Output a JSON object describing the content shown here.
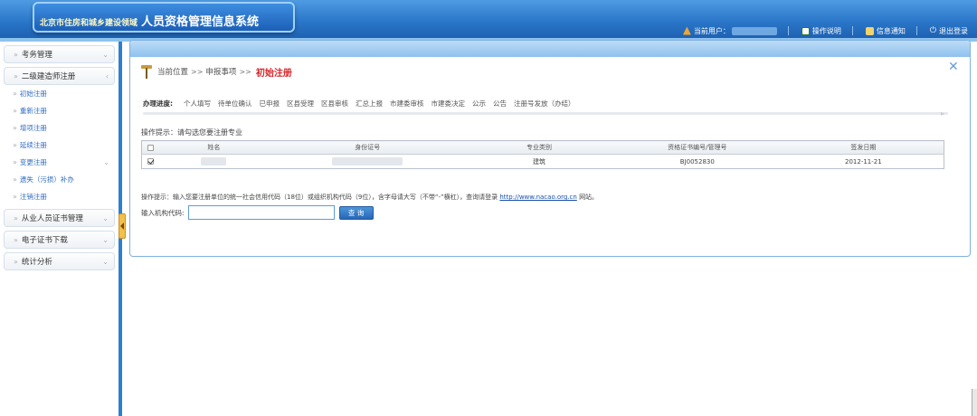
{
  "header": {
    "logo_small": "北京市住房和城乡建设领域",
    "logo_big": "人员资格管理信息系统",
    "current_user_label": "当前用户：",
    "help": "操作说明",
    "notice": "信息通知",
    "logout": "退出登录"
  },
  "sidebar": {
    "groups": [
      {
        "label": "考务管理"
      },
      {
        "label": "二级建造师注册"
      }
    ],
    "sub_items": [
      {
        "label": "初始注册"
      },
      {
        "label": "重新注册"
      },
      {
        "label": "增项注册"
      },
      {
        "label": "延续注册"
      },
      {
        "label": "变更注册"
      },
      {
        "label": "遗失（污损）补办"
      },
      {
        "label": "注销注册"
      }
    ],
    "groups2": [
      {
        "label": "从业人员证书管理"
      },
      {
        "label": "电子证书下载"
      },
      {
        "label": "统计分析"
      }
    ]
  },
  "breadcrumb": {
    "current_position": "当前位置",
    "sep": ">>",
    "section": "申报事项",
    "current": "初始注册"
  },
  "progress": {
    "title": "办理进度:",
    "steps": [
      "个人填写",
      "待单位确认",
      "已申报",
      "区县受理",
      "区县审核",
      "汇总上报",
      "市建委审核",
      "市建委决定",
      "公示",
      "公告",
      "注册号发放（办结）"
    ]
  },
  "tip1": "操作提示：请勾选您要注册专业",
  "table": {
    "headers": [
      "",
      "姓名",
      "身份证号",
      "专业类别",
      "资格证书编号/管理号",
      "签发日期"
    ],
    "rows": [
      {
        "major": "建筑",
        "cert_no": "BJ0052830",
        "date": "2012-11-21"
      }
    ]
  },
  "tip2": {
    "text": "操作提示：输入您要注册单位的统一社会信用代码（18位）或组织机构代码（9位），含字母请大写（不带“-”横杠），查询请登录",
    "link": "http://www.nacao.org.cn",
    "suffix": "网站。"
  },
  "org": {
    "label": "输入机构代码:",
    "value": "",
    "button": "查 询"
  },
  "colors": {
    "header_blue": "#2a76c8",
    "accent_red": "#d6262a",
    "link_blue": "#2f6cc2"
  }
}
